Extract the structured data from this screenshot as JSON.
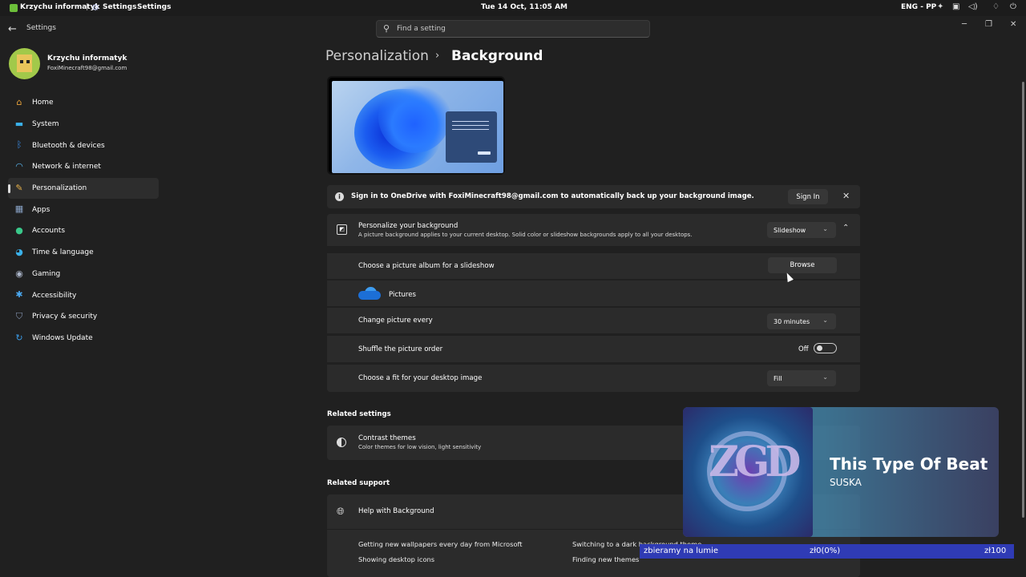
{
  "taskbar": {
    "app_title": "Krzychu informatyk",
    "separator": "|",
    "settings_label": "Settings",
    "settings_title": "Settings",
    "clock": "Tue 14 Oct, 11:05 AM",
    "language": "ENG - PP"
  },
  "window": {
    "title": "Settings",
    "search_placeholder": "Find a setting"
  },
  "user": {
    "name": "Krzychu informatyk",
    "email": "FoxiMinecraft98@gmail.com"
  },
  "sidebar": {
    "items": [
      {
        "label": "Home",
        "icon": "home-icon",
        "color": "#e8a23a"
      },
      {
        "label": "System",
        "icon": "system-icon",
        "color": "#3ab0e8"
      },
      {
        "label": "Bluetooth & devices",
        "icon": "bluetooth-icon",
        "color": "#3a8de8"
      },
      {
        "label": "Network & internet",
        "icon": "wifi-icon",
        "color": "#5ab8f0"
      },
      {
        "label": "Personalization",
        "icon": "brush-icon",
        "color": "#e8b24a",
        "active": true
      },
      {
        "label": "Apps",
        "icon": "apps-icon",
        "color": "#8aa4c8"
      },
      {
        "label": "Accounts",
        "icon": "accounts-icon",
        "color": "#3ac88a"
      },
      {
        "label": "Time & language",
        "icon": "globe-clock-icon",
        "color": "#3ab0e8"
      },
      {
        "label": "Gaming",
        "icon": "gaming-icon",
        "color": "#aab4c8"
      },
      {
        "label": "Accessibility",
        "icon": "accessibility-icon",
        "color": "#4aa8f0"
      },
      {
        "label": "Privacy & security",
        "icon": "shield-icon",
        "color": "#8a9ab8"
      },
      {
        "label": "Windows Update",
        "icon": "update-icon",
        "color": "#3a9be8"
      }
    ]
  },
  "breadcrumb": {
    "parent": "Personalization",
    "separator": "›",
    "current": "Background"
  },
  "notice": {
    "text": "Sign in to OneDrive with FoxiMinecraft98@gmail.com to automatically back up your background image.",
    "sign_in_label": "Sign In"
  },
  "personalize": {
    "title": "Personalize your background",
    "description": "A picture background applies to your current desktop. Solid color or slideshow backgrounds apply to all your desktops.",
    "selected": "Slideshow",
    "album_label": "Choose a picture album for a slideshow",
    "browse_label": "Browse",
    "folder_name": "Pictures",
    "interval_label": "Change picture every",
    "interval_value": "30 minutes",
    "shuffle_label": "Shuffle the picture order",
    "shuffle_state": "Off",
    "fit_label": "Choose a fit for your desktop image",
    "fit_value": "Fill"
  },
  "related_settings": {
    "heading": "Related settings",
    "contrast_title": "Contrast themes",
    "contrast_desc": "Color themes for low vision, light sensitivity"
  },
  "related_support": {
    "heading": "Related support",
    "help_title": "Help with Background",
    "links": [
      "Getting new wallpapers every day from Microsoft",
      "Switching to a dark background theme",
      "Showing desktop icons",
      "Finding new themes"
    ]
  },
  "music": {
    "title": "This Type Of Beat",
    "artist": "SUSKA"
  },
  "donation": {
    "label": "zbieramy na lumie",
    "progress": "zł0(0%)",
    "goal": "zł100"
  }
}
